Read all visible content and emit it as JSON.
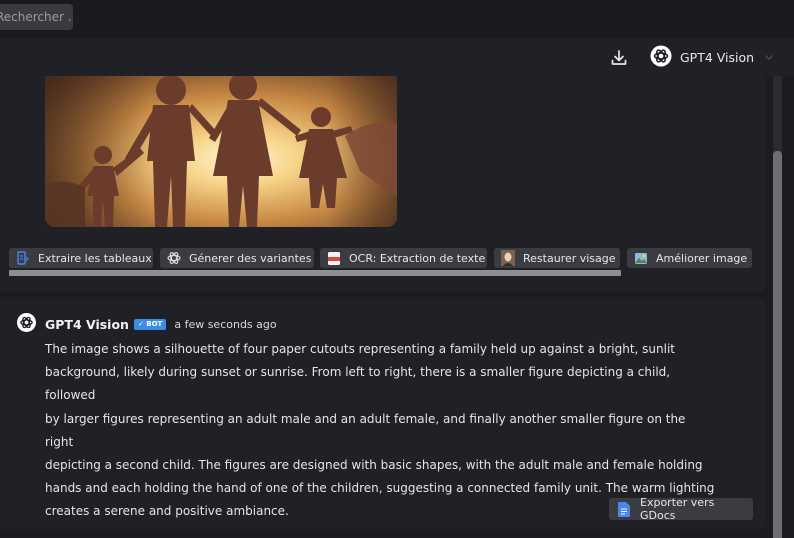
{
  "search": {
    "placeholder": "Rechercher ..."
  },
  "header": {
    "model_name": "GPT4 Vision"
  },
  "tools": [
    {
      "label": "Extraire les tableaux",
      "icon": "table-extract-icon"
    },
    {
      "label": "Génerer des variantes",
      "icon": "openai-logo-icon"
    },
    {
      "label": "OCR: Extraction de texte",
      "icon": "ocr-icon"
    },
    {
      "label": "Restaurer visage",
      "icon": "portrait-icon"
    },
    {
      "label": "Améliorer image",
      "icon": "enhance-image-icon"
    }
  ],
  "message": {
    "author": "GPT4 Vision",
    "badge": "✓ BOT",
    "timestamp": "a few seconds ago",
    "lines": [
      "The image shows a silhouette of four paper cutouts representing a family held up against a bright, sunlit",
      "background, likely during sunset or sunrise. From left to right, there is a smaller figure depicting a child, followed",
      "by larger figures representing an adult male and an adult female, and finally another smaller figure on the right",
      "depicting a second child. The figures are designed with basic shapes, with the adult male and female holding",
      "hands and each holding the hand of one of the children, suggesting a connected family unit. The warm lighting",
      "creates a serene and positive ambiance."
    ]
  },
  "export": {
    "label": "Exporter vers GDocs"
  },
  "colors": {
    "background": "#1b1c21",
    "panel": "#202126",
    "chip": "#3b3c42",
    "badge": "#3a8ee6",
    "gdocs": "#4a86f0"
  }
}
